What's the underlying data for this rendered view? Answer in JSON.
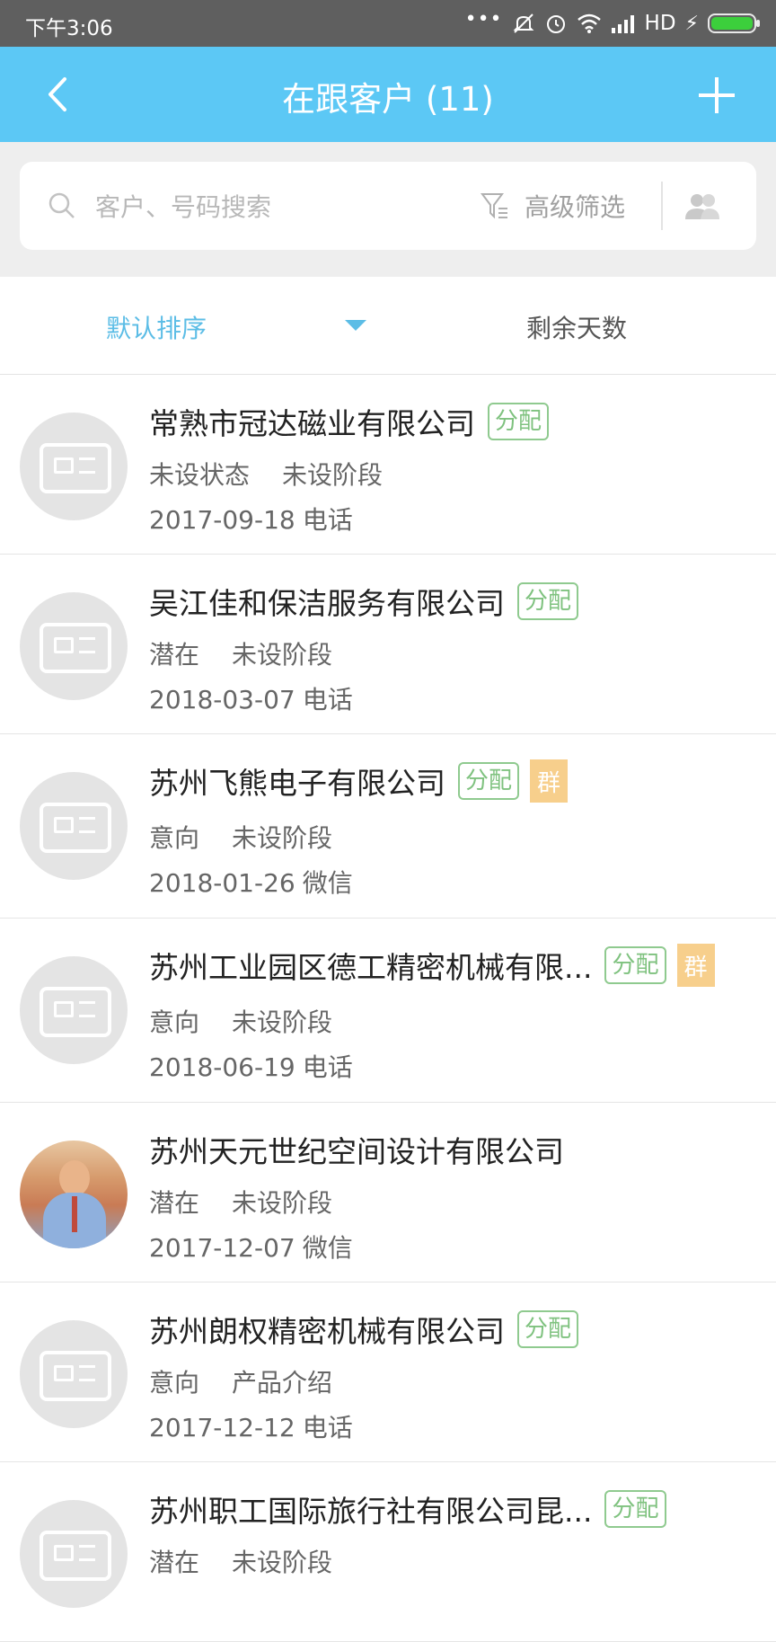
{
  "status_bar": {
    "time": "下午3:06",
    "dots": "•••",
    "network": "HD"
  },
  "header": {
    "back_icon": "chevron-left-icon",
    "title": "在跟客户 (11)",
    "add_icon": "plus-icon"
  },
  "search": {
    "placeholder": "客户、号码搜索",
    "filter_label": "高级筛选",
    "search_icon": "search-icon",
    "filter_icon": "filter-icon",
    "people_icon": "people-icon"
  },
  "sort": {
    "default_label": "默认排序",
    "days_label": "剩余天数"
  },
  "colors": {
    "header": "#5cc8f5",
    "accent": "#5cbde6",
    "assign_tag": "#7fc27f",
    "group_tag": "#f7cf8c"
  },
  "customers": [
    {
      "name": "常熟市冠达磁业有限公司",
      "assign": "分配",
      "group": "",
      "status": "未设状态",
      "stage": "未设阶段",
      "date": "2017-09-18",
      "channel": "电话",
      "avatar": "card"
    },
    {
      "name": "吴江佳和保洁服务有限公司",
      "assign": "分配",
      "group": "",
      "status": "潜在",
      "stage": "未设阶段",
      "date": "2018-03-07",
      "channel": "电话",
      "avatar": "card"
    },
    {
      "name": "苏州飞熊电子有限公司",
      "assign": "分配",
      "group": "群",
      "status": "意向",
      "stage": "未设阶段",
      "date": "2018-01-26",
      "channel": "微信",
      "avatar": "card"
    },
    {
      "name": "苏州工业园区德工精密机械有限...",
      "assign": "分配",
      "group": "群",
      "status": "意向",
      "stage": "未设阶段",
      "date": "2018-06-19",
      "channel": "电话",
      "avatar": "card"
    },
    {
      "name": "苏州天元世纪空间设计有限公司",
      "assign": "",
      "group": "",
      "status": "潜在",
      "stage": "未设阶段",
      "date": "2017-12-07",
      "channel": "微信",
      "avatar": "photo"
    },
    {
      "name": "苏州朗权精密机械有限公司",
      "assign": "分配",
      "group": "",
      "status": "意向",
      "stage": "产品介绍",
      "date": "2017-12-12",
      "channel": "电话",
      "avatar": "card"
    },
    {
      "name": "苏州职工国际旅行社有限公司昆...",
      "assign": "分配",
      "group": "",
      "status": "潜在",
      "stage": "未设阶段",
      "date": "",
      "channel": "",
      "avatar": "card"
    }
  ]
}
